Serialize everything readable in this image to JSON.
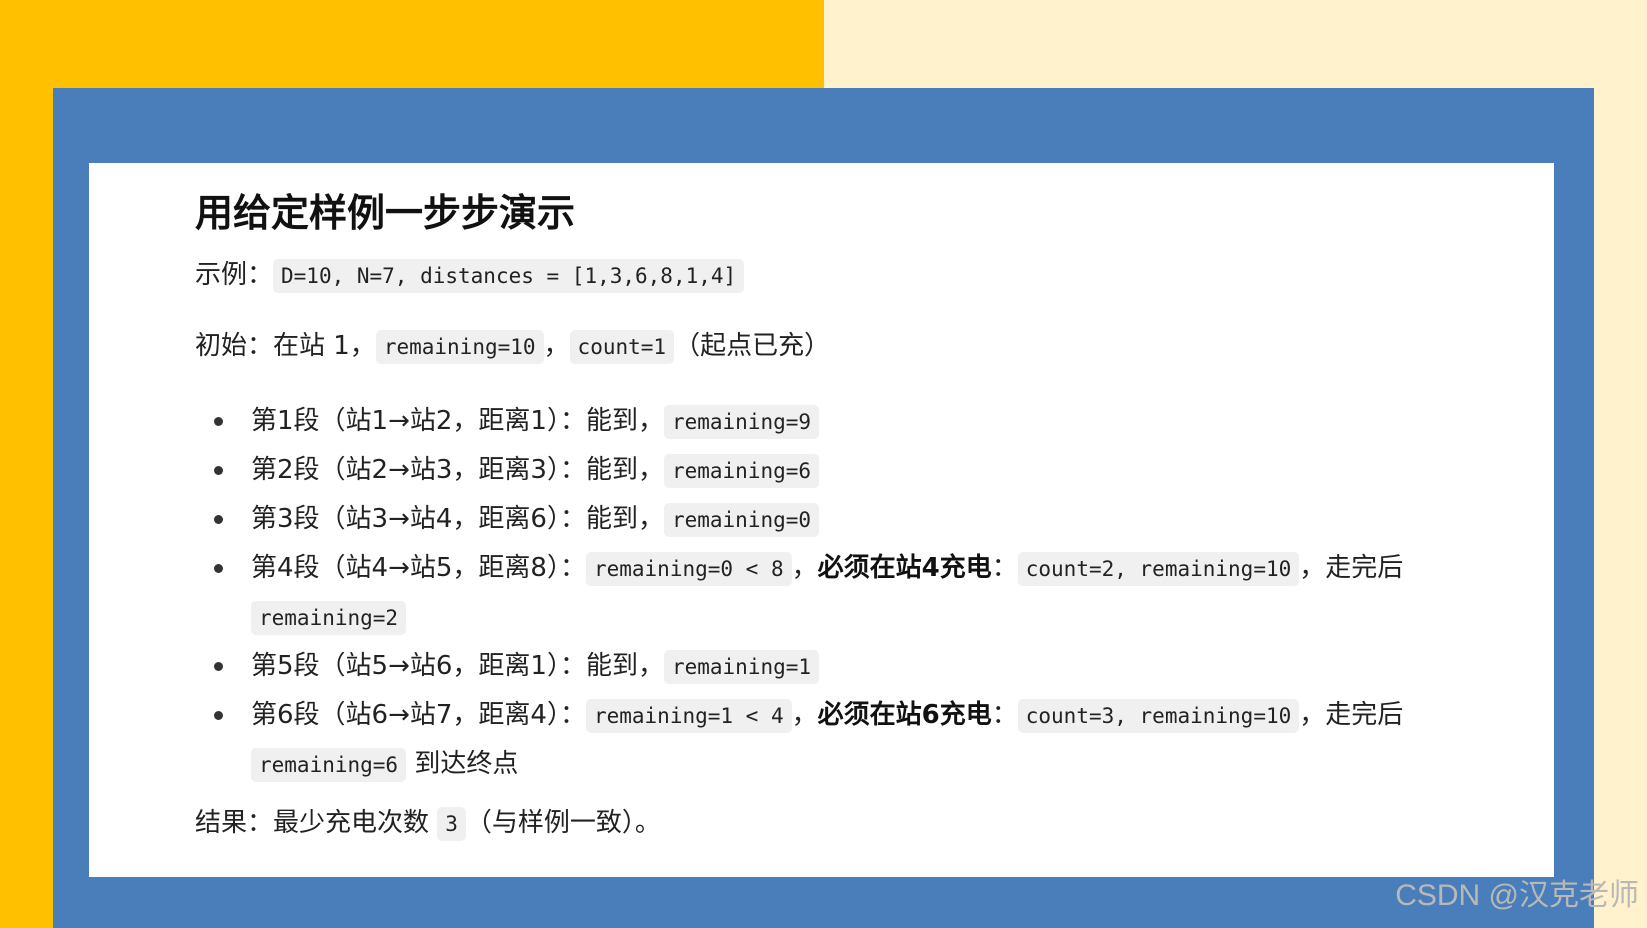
{
  "title": "用给定样例一步步演示",
  "example": {
    "label": "示例：",
    "code": "D=10, N=7, distances = [1,3,6,8,1,4]"
  },
  "initial": {
    "prefix": "初始：在站 1，",
    "code1": "remaining=10",
    "sep": "，",
    "code2": "count=1",
    "suffix": "（起点已充）"
  },
  "steps": [
    {
      "text": "第1段（站1→站2，距离1）：能到，",
      "code": "remaining=9"
    },
    {
      "text": "第2段（站2→站3，距离3）：能到，",
      "code": "remaining=6"
    },
    {
      "text": "第3段（站3→站4，距离6）：能到，",
      "code": "remaining=0"
    },
    {
      "text": "第4段（站4→站5，距离8）：",
      "code": "remaining=0 < 8",
      "sep": "，",
      "bold": "必须在站4充电",
      "colon": "：",
      "code2": "count=2, remaining=10",
      "after": "，走完后",
      "code3": "remaining=2",
      "tail": ""
    },
    {
      "text": "第5段（站5→站6，距离1）：能到，",
      "code": "remaining=1"
    },
    {
      "text": "第6段（站6→站7，距离4）：",
      "code": "remaining=1 < 4",
      "sep": "，",
      "bold": "必须在站6充电",
      "colon": "：",
      "code2": "count=3, remaining=10",
      "after": "，走完后",
      "code3": "remaining=6",
      "tail": " 到达终点"
    }
  ],
  "result": {
    "prefix": "结果：最少充电次数 ",
    "code": "3",
    "suffix": "（与样例一致）。"
  },
  "watermark": "CSDN @汉克老师",
  "colors": {
    "left_bg": "#FFC000",
    "right_bg": "#FFF2CC",
    "frame": "#4A7EBB",
    "card": "#FFFFFF",
    "code_bg": "#F0F0F0"
  }
}
